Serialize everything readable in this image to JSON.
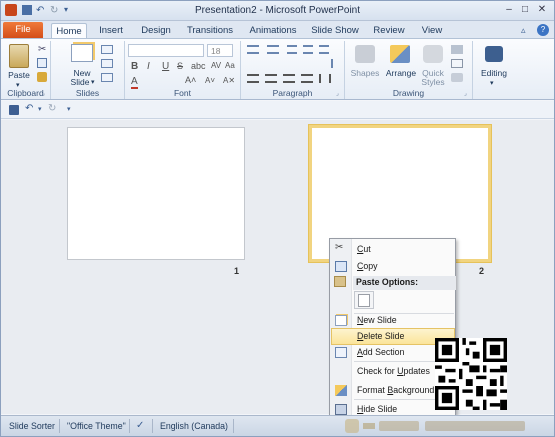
{
  "window": {
    "title": "Presentation2  -  Microsoft PowerPoint"
  },
  "tabs": {
    "file": "File",
    "items": [
      "Home",
      "Insert",
      "Design",
      "Transitions",
      "Animations",
      "Slide Show",
      "Review",
      "View"
    ]
  },
  "ribbon": {
    "clipboard": {
      "label": "Clipboard",
      "paste": "Paste"
    },
    "slides": {
      "label": "Slides",
      "new_slide_line1": "New",
      "new_slide_line2": "Slide"
    },
    "font": {
      "label": "Font",
      "size_value": "18"
    },
    "paragraph": {
      "label": "Paragraph"
    },
    "drawing": {
      "label": "Drawing",
      "shapes": "Shapes",
      "arrange": "Arrange",
      "quick_styles_line1": "Quick",
      "quick_styles_line2": "Styles"
    },
    "editing": {
      "label": "Editing"
    }
  },
  "slides": [
    {
      "number": "1"
    },
    {
      "number": "2"
    }
  ],
  "context_menu": {
    "cut": "Cut",
    "copy": "Copy",
    "paste_options": "Paste Options:",
    "new_slide": "New Slide",
    "delete_slide": "Delete Slide",
    "add_section": "Add Section",
    "check_updates": "Check for Updates",
    "format_background": "Format Background...",
    "hide_slide": "Hide Slide"
  },
  "statusbar": {
    "view": "Slide Sorter",
    "theme": "\"Office Theme\"",
    "language": "English (Canada)"
  },
  "colors": {
    "file_tab": "#d24b16",
    "selection": "#f1d480",
    "menu_highlight": "#fbe49a"
  }
}
